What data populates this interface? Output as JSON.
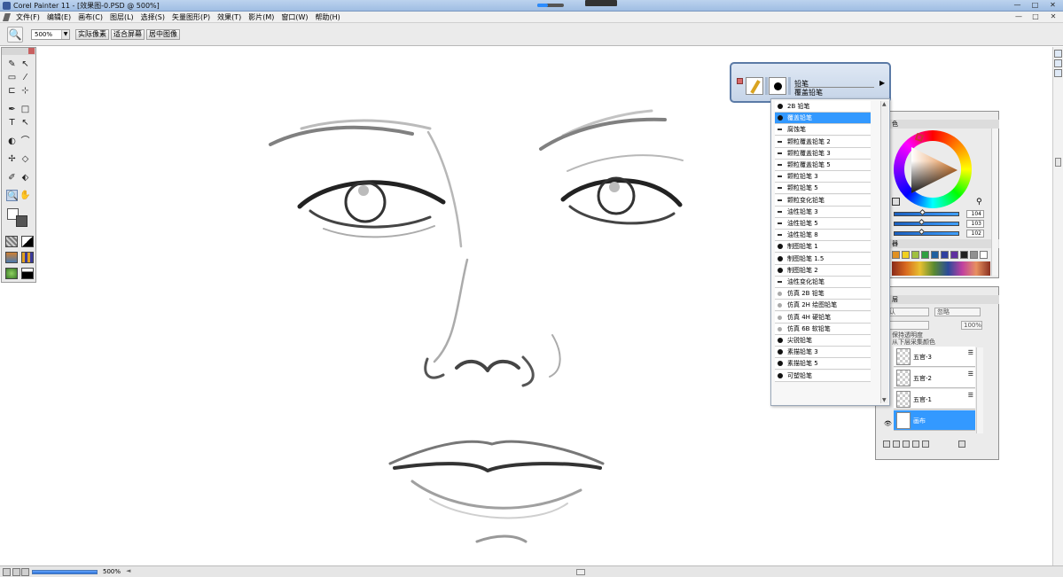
{
  "window": {
    "title": "Corel Painter 11 - [效果图-0.PSD @ 500%]",
    "min_glyph": "—",
    "max_glyph": "□",
    "close_glyph": "✕"
  },
  "menu": {
    "items": [
      "文件(F)",
      "编辑(E)",
      "画布(C)",
      "图层(L)",
      "选择(S)",
      "矢量图形(P)",
      "效果(T)",
      "影片(M)",
      "窗口(W)",
      "帮助(H)"
    ]
  },
  "property_bar": {
    "zoom_value": "500%",
    "dropdown_glyph": "▼",
    "actual_pixels": "实际像素",
    "fit_screen": "适合屏幕",
    "center_image": "居中图像"
  },
  "brush_selector": {
    "category": "铅笔",
    "variant": "覆盖铅笔",
    "arrow_glyph": "▶"
  },
  "variant_list": {
    "items": [
      {
        "label": "2B 铅笔",
        "dab": "round"
      },
      {
        "label": "覆盖铅笔",
        "dab": "round",
        "selected": true
      },
      {
        "label": "腐蚀笔",
        "dab": "line"
      },
      {
        "label": "颗粒覆盖铅笔 2",
        "dab": "line"
      },
      {
        "label": "颗粒覆盖铅笔 3",
        "dab": "line"
      },
      {
        "label": "颗粒覆盖铅笔 5",
        "dab": "line"
      },
      {
        "label": "颗粒铅笔 3",
        "dab": "line"
      },
      {
        "label": "颗粒铅笔 5",
        "dab": "line"
      },
      {
        "label": "颗粒变化铅笔",
        "dab": "line"
      },
      {
        "label": "油性铅笔 3",
        "dab": "line"
      },
      {
        "label": "油性铅笔 5",
        "dab": "line"
      },
      {
        "label": "油性铅笔 8",
        "dab": "line"
      },
      {
        "label": "制图铅笔 1",
        "dab": "round"
      },
      {
        "label": "制图铅笔 1.5",
        "dab": "round"
      },
      {
        "label": "制图铅笔 2",
        "dab": "round"
      },
      {
        "label": "油性变化铅笔",
        "dab": "line"
      },
      {
        "label": "仿真 2B 铅笔",
        "dab": "soft"
      },
      {
        "label": "仿真 2H 绘图铅笔",
        "dab": "soft"
      },
      {
        "label": "仿真 4H 硬铅笔",
        "dab": "soft"
      },
      {
        "label": "仿真 6B 软铅笔",
        "dab": "soft"
      },
      {
        "label": "尖锐铅笔",
        "dab": "round"
      },
      {
        "label": "素描铅笔 3",
        "dab": "round"
      },
      {
        "label": "素描铅笔 5",
        "dab": "round"
      },
      {
        "label": "可塑铅笔",
        "dab": "round"
      }
    ]
  },
  "color_panel": {
    "title": "色",
    "r": "104",
    "g": "103",
    "b": "102",
    "r_fraction": 0.41,
    "g_fraction": 0.4,
    "b_fraction": 0.4,
    "mixer_title": "器",
    "swatches": [
      "#e09020",
      "#f0d020",
      "#a0c040",
      "#30a040",
      "#2060a0",
      "#3040a0",
      "#6030a0",
      "#202020",
      "#909090",
      "#ffffff"
    ]
  },
  "layers_panel": {
    "title": "层",
    "composite_method": "认",
    "composite_depth": "忽略",
    "opacity": "100%",
    "preserve_transparency": "保持透明度",
    "pick_up_underlying": "从下层采集颜色",
    "layers": [
      {
        "name": "五官-3",
        "selected": false
      },
      {
        "name": "五官-2",
        "selected": false
      },
      {
        "name": "五官-1",
        "selected": false
      },
      {
        "name": "画布",
        "selected": true
      }
    ],
    "stack_glyph": "☰",
    "eye_glyph": "👁"
  },
  "status_bar": {
    "zoom": "500%",
    "arrow_glyph": "◄"
  }
}
